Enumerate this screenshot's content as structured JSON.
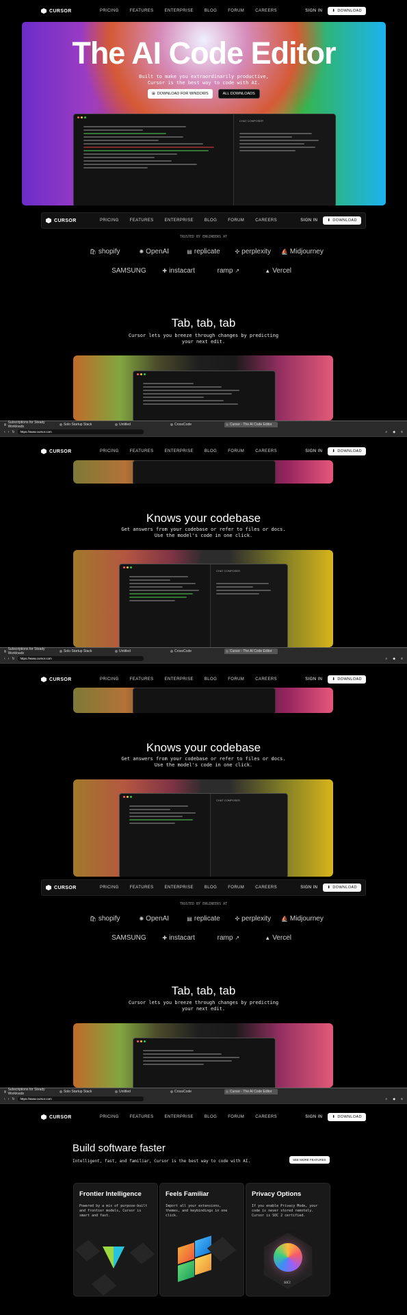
{
  "top_nav": {
    "brand": "CURSOR",
    "links": [
      "PRICING",
      "FEATURES",
      "ENTERPRISE",
      "BLOG",
      "FORUM",
      "CAREERS"
    ],
    "sign_in": "SIGN IN",
    "download": "DOWNLOAD"
  },
  "hero": {
    "title": "The AI Code Editor",
    "subtitle_line1": "Built to make you extraordinarily productive,",
    "subtitle_line2": "Cursor is the best way to code with AI.",
    "primary_button": "DOWNLOAD FOR WINDOWS",
    "secondary_button": "ALL DOWNLOADS"
  },
  "trusted": {
    "label": "TRUSTED BY ENGINEERS AT",
    "row1": [
      "shopify",
      "OpenAI",
      "replicate",
      "perplexity",
      "Midjourney"
    ],
    "row2": [
      "SAMSUNG",
      "instacart",
      "ramp",
      "Vercel"
    ]
  },
  "tab_section": {
    "title": "Tab, tab, tab",
    "subtitle_line1": "Cursor lets you breeze through changes by predicting",
    "subtitle_line2": "your next edit."
  },
  "codebase_section": {
    "title": "Knows your codebase",
    "subtitle_line1": "Get answers from your codebase or refer to files or docs.",
    "subtitle_line2": "Use the model's code in one click."
  },
  "browser": {
    "tabs": [
      "Subscriptions for Steady Workloads",
      "Solo Startup Stack",
      "Untitled",
      "CrossCode",
      "Cursor - The AI Code Editor"
    ],
    "url": "https://www.cursor.com"
  },
  "build_section": {
    "title": "Build software faster",
    "subtitle": "Intelligent, fast, and familiar, Cursor is the best way to code with AI.",
    "button": "SEE MORE FEATURES"
  },
  "cards": [
    {
      "title": "Frontier Intelligence",
      "body": "Powered by a mix of purpose-built and frontier models, Cursor is smart and fast."
    },
    {
      "title": "Feels Familiar",
      "body": "Import all your extensions, themes, and keybindings in one click."
    },
    {
      "title": "Privacy Options",
      "body": "If you enable Privacy Mode, your code is never stored remotely. Cursor is SOC 2 certified."
    }
  ],
  "editor_tabs": {
    "chat": "CHAT",
    "composer": "COMPOSER"
  },
  "soc_badge": "SOC2",
  "colors": {
    "accent_orange": "#e56a2d",
    "accent_pink": "#e24a7a",
    "accent_green": "#3aa34f",
    "background": "#000000"
  }
}
